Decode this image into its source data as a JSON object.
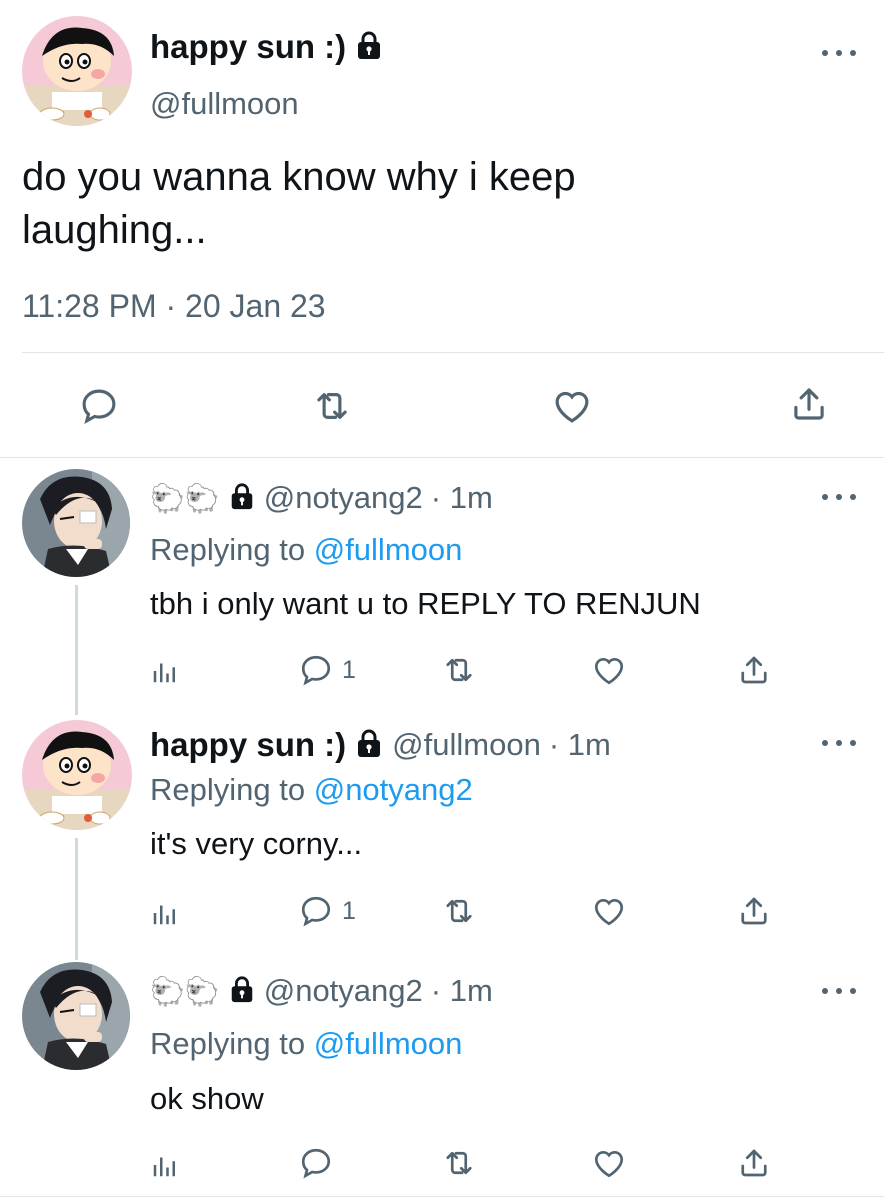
{
  "main_tweet": {
    "display_name": "happy sun :)",
    "handle": "@fullmoon",
    "text_line1": "do you wanna know why i keep",
    "text_line2": "laughing...",
    "timestamp": "11:28 PM · 20 Jan 23",
    "avatar_icon": "cartoon-boy-avatar"
  },
  "replies": [
    {
      "emoji_name": "🐑🐑",
      "handle": "@notyang2",
      "time": "· 1m",
      "replying_label": "Replying to",
      "replying_to": "@fullmoon",
      "text": "tbh i only want u to REPLY TO RENJUN",
      "reply_count": "1",
      "avatar_icon": "anime-boy-avatar"
    },
    {
      "display_name": "happy sun :)",
      "handle": "@fullmoon",
      "time": "· 1m",
      "replying_label": "Replying to",
      "replying_to": "@notyang2",
      "text": "it's very corny...",
      "reply_count": "1",
      "avatar_icon": "cartoon-boy-avatar"
    },
    {
      "emoji_name": "🐑🐑",
      "handle": "@notyang2",
      "time": "· 1m",
      "replying_label": "Replying to",
      "replying_to": "@fullmoon",
      "text": "ok show",
      "reply_count": "",
      "avatar_icon": "anime-boy-avatar"
    }
  ],
  "colors": {
    "text": "#0f1419",
    "secondary": "#536471",
    "link": "#1d9bf0",
    "divider": "#e1e5e8"
  }
}
